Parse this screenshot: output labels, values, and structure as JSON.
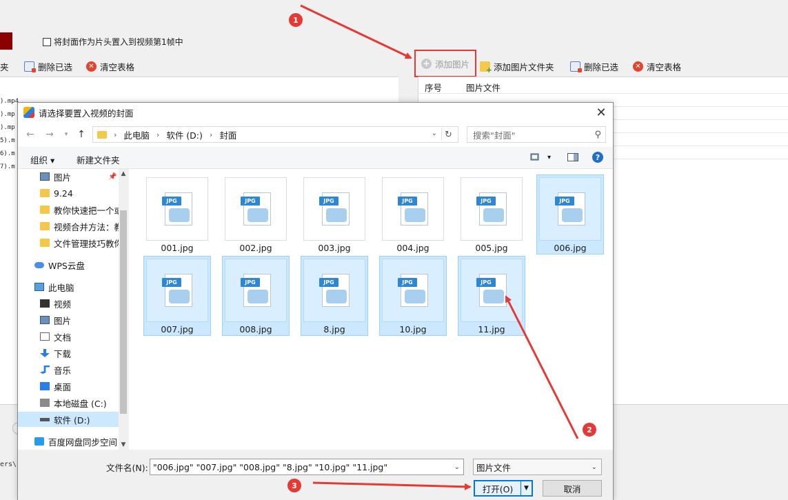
{
  "app": {
    "cover_checkbox_label": "将封面作为片头置入到视频第1帧中",
    "left_toolbar": {
      "folder_tail": "夹",
      "delete_selected": "删除已选",
      "clear_table": "清空表格"
    },
    "right_toolbar": {
      "add_image": "添加图片",
      "add_image_folder": "添加图片文件夹",
      "delete_selected": "删除已选",
      "clear_table": "清空表格"
    },
    "table_headers": {
      "index": "序号",
      "image_file": "图片文件"
    },
    "file_rows": [
      ").mp4",
      ").mp",
      ").mp",
      "5).m",
      "6).m",
      "7).m"
    ],
    "path_fragment": "ers\\"
  },
  "dialog": {
    "title": "请选择要置入视频的封面",
    "breadcrumb": [
      "此电脑",
      "软件 (D:)",
      "封面"
    ],
    "search_placeholder": "搜索\"封面\"",
    "organize": "组织 ▾",
    "new_folder": "新建文件夹",
    "nav_items": [
      {
        "label": "图片",
        "icon": "pictures-icon"
      },
      {
        "label": "9.24",
        "icon": "folder-icon"
      },
      {
        "label": "教你快速把一个或",
        "icon": "folder-icon"
      },
      {
        "label": "视频合并方法：教",
        "icon": "folder-icon"
      },
      {
        "label": "文件管理技巧教你",
        "icon": "folder-icon"
      },
      {
        "label": "WPS云盘",
        "icon": "cloud-icon"
      },
      {
        "label": "此电脑",
        "icon": "computer-icon"
      },
      {
        "label": "视频",
        "icon": "video-icon"
      },
      {
        "label": "图片",
        "icon": "pictures-icon"
      },
      {
        "label": "文档",
        "icon": "document-icon"
      },
      {
        "label": "下载",
        "icon": "download-icon"
      },
      {
        "label": "音乐",
        "icon": "music-icon"
      },
      {
        "label": "桌面",
        "icon": "desktop-icon"
      },
      {
        "label": "本地磁盘 (C:)",
        "icon": "drive-c-icon"
      },
      {
        "label": "软件 (D:)",
        "icon": "drive-d-icon"
      },
      {
        "label": "百度网盘同步空间",
        "icon": "baidu-netdisk-icon"
      }
    ],
    "files": [
      {
        "name": "001.jpg",
        "selected": false
      },
      {
        "name": "002.jpg",
        "selected": false
      },
      {
        "name": "003.jpg",
        "selected": false
      },
      {
        "name": "004.jpg",
        "selected": false
      },
      {
        "name": "005.jpg",
        "selected": false
      },
      {
        "name": "006.jpg",
        "selected": true
      },
      {
        "name": "007.jpg",
        "selected": true
      },
      {
        "name": "008.jpg",
        "selected": true
      },
      {
        "name": "8.jpg",
        "selected": true
      },
      {
        "name": "10.jpg",
        "selected": true
      },
      {
        "name": "11.jpg",
        "selected": true
      }
    ],
    "jpg_badge": "JPG",
    "filename_label": "文件名(N):",
    "filename_value": "\"006.jpg\" \"007.jpg\" \"008.jpg\" \"8.jpg\" \"10.jpg\" \"11.jpg\"",
    "file_type": "图片文件",
    "open_label": "打开(O)",
    "cancel_label": "取消"
  },
  "annotations": {
    "marker_1": "1",
    "marker_2": "2",
    "marker_3": "3",
    "color": "#e53935"
  }
}
